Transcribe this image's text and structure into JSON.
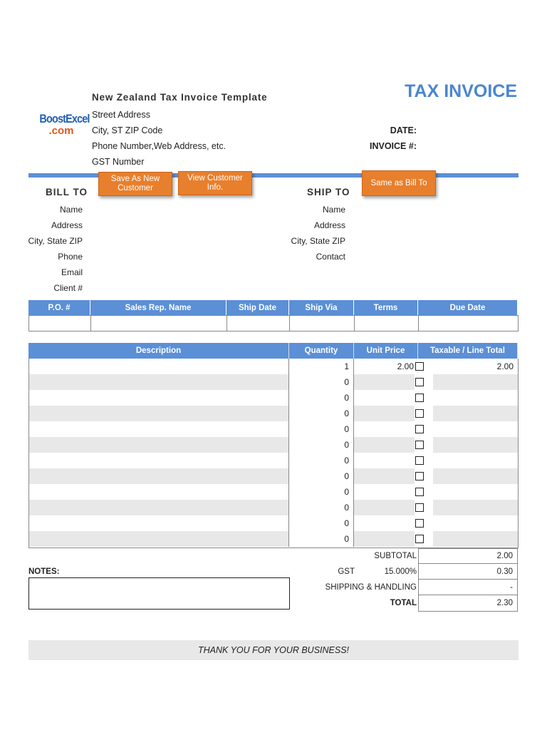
{
  "company": {
    "title": "New Zealand Tax Invoice Template",
    "street": "Street Address",
    "city": "City, ST  ZIP Code",
    "phone": "Phone Number,Web Address, etc.",
    "gst": "GST Number",
    "logo_main": "BoostExcel",
    "logo_sub": ".com"
  },
  "invoice": {
    "heading": "TAX INVOICE",
    "date_label": "DATE:",
    "number_label": "INVOICE #:"
  },
  "buttons": {
    "save_customer": "Save As New Customer",
    "view_customer": "View Customer Info.",
    "same_as_bill": "Same as Bill To"
  },
  "bill_to": {
    "heading": "BILL TO",
    "fields": [
      "Name",
      "Address",
      "City, State ZIP",
      "Phone",
      "Email",
      "Client #"
    ]
  },
  "ship_to": {
    "heading": "SHIP TO",
    "fields": [
      "Name",
      "Address",
      "City, State ZIP",
      "Contact"
    ]
  },
  "order_table": {
    "headers": [
      "P.O. #",
      "Sales Rep. Name",
      "Ship Date",
      "Ship Via",
      "Terms",
      "Due Date"
    ]
  },
  "items_table": {
    "headers": [
      "Description",
      "Quantity",
      "Unit Price",
      "Taxable /  Line Total"
    ],
    "rows": [
      {
        "qty": "1",
        "price": "2.00",
        "total": "2.00"
      },
      {
        "qty": "0"
      },
      {
        "qty": "0"
      },
      {
        "qty": "0"
      },
      {
        "qty": "0"
      },
      {
        "qty": "0"
      },
      {
        "qty": "0"
      },
      {
        "qty": "0"
      },
      {
        "qty": "0"
      },
      {
        "qty": "0"
      },
      {
        "qty": "0"
      },
      {
        "qty": "0"
      }
    ]
  },
  "totals": [
    {
      "label": "SUBTOTAL",
      "extra": "",
      "value": "2.00"
    },
    {
      "label": "GST",
      "extra": "15.000%",
      "value": "0.30"
    },
    {
      "label": "SHIPPING & HANDLING",
      "extra": "",
      "value": "-"
    },
    {
      "label": "TOTAL",
      "extra": "",
      "value": "2.30"
    }
  ],
  "notes_label": "NOTES:",
  "footer": "THANK YOU FOR YOUR BUSINESS!",
  "colors": {
    "accent": "#5b8fd6",
    "button": "#e87f2c",
    "heading": "#4a86cf"
  }
}
